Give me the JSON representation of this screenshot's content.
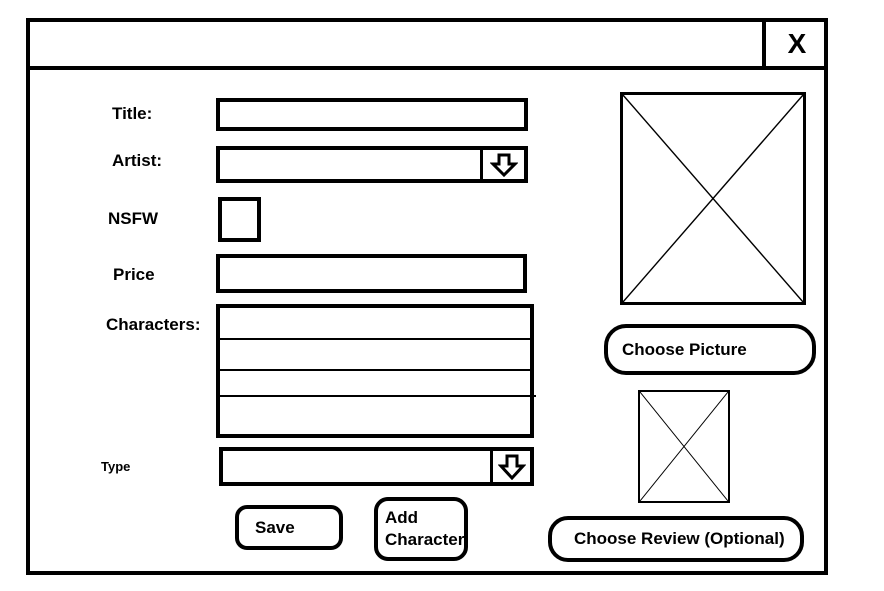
{
  "window": {
    "close_label": "X"
  },
  "form": {
    "title_label": "Title:",
    "title_value": "",
    "artist_label": "Artist:",
    "artist_value": "",
    "nsfw_label": "NSFW",
    "nsfw_checked": false,
    "price_label": "Price",
    "price_value": "",
    "characters_label": "Characters:",
    "characters_items": [
      "",
      "",
      "",
      ""
    ],
    "type_label": "Type",
    "type_value": ""
  },
  "buttons": {
    "save_label": "Save",
    "add_character_line1": "Add",
    "add_character_line2": "Character",
    "choose_picture_label": "Choose Picture",
    "choose_review_label": "Choose Review (Optional)"
  },
  "icons": {
    "close": "close-icon",
    "dropdown": "down-arrow-icon",
    "placeholder": "image-placeholder-icon"
  }
}
